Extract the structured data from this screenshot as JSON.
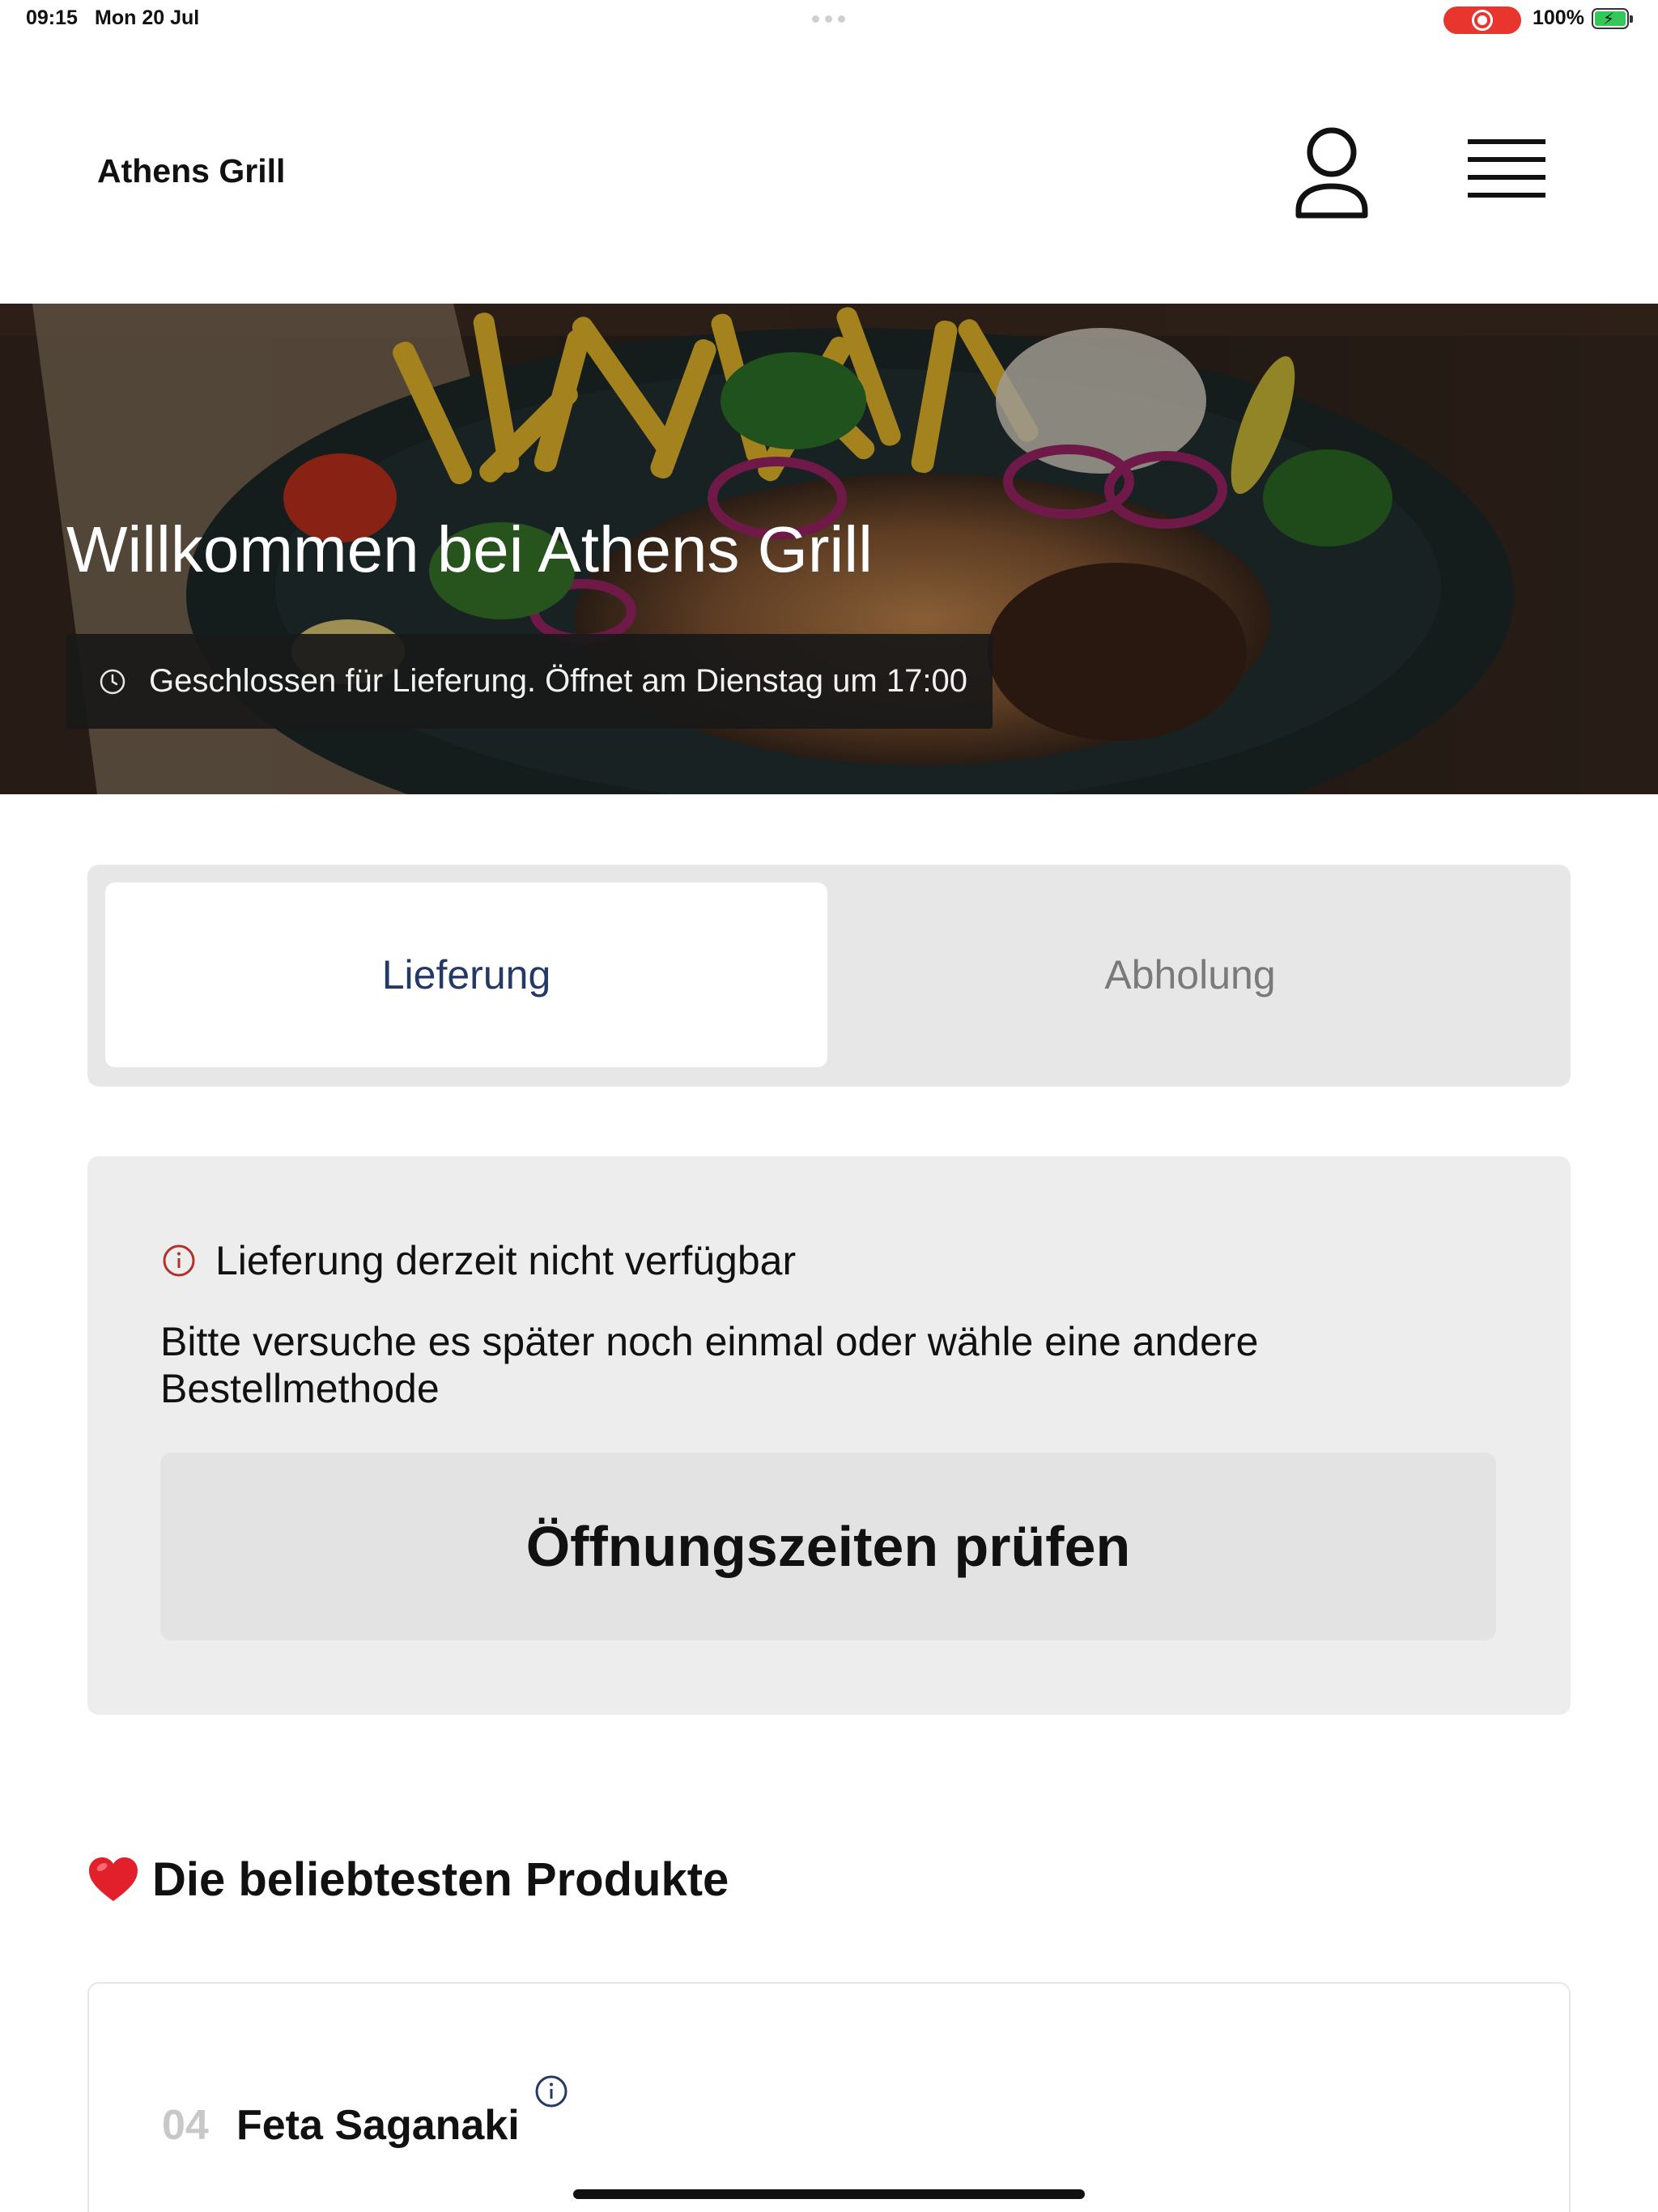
{
  "status_bar": {
    "time": "09:15",
    "date": "Mon 20 Jul",
    "battery": "100%",
    "recording_color": "#e8352e"
  },
  "header": {
    "brand": "Athens Grill",
    "profile_icon": "user-icon",
    "menu_icon": "hamburger-menu-icon"
  },
  "hero": {
    "title": "Willkommen bei Athens Grill",
    "hours_notice": "Geschlossen für Lieferung. Öffnet am Dienstag um 17:00",
    "hours_icon": "clock-icon"
  },
  "order_method": {
    "tabs": [
      {
        "label": "Lieferung",
        "selected": true
      },
      {
        "label": "Abholung",
        "selected": false
      }
    ],
    "active_color": "#243966"
  },
  "notice": {
    "icon": "info-icon",
    "icon_color": "#b3302b",
    "title": "Lieferung derzeit nicht verfügbar",
    "body": "Bitte versuche es später noch einmal oder wähle eine andere Bestellmethode",
    "button_label": "Öffnungszeiten prüfen"
  },
  "popular": {
    "icon": "heart-icon",
    "title": "Die beliebtesten Produkte",
    "products": [
      {
        "number": "04",
        "name": "Feta Saganaki"
      }
    ]
  }
}
